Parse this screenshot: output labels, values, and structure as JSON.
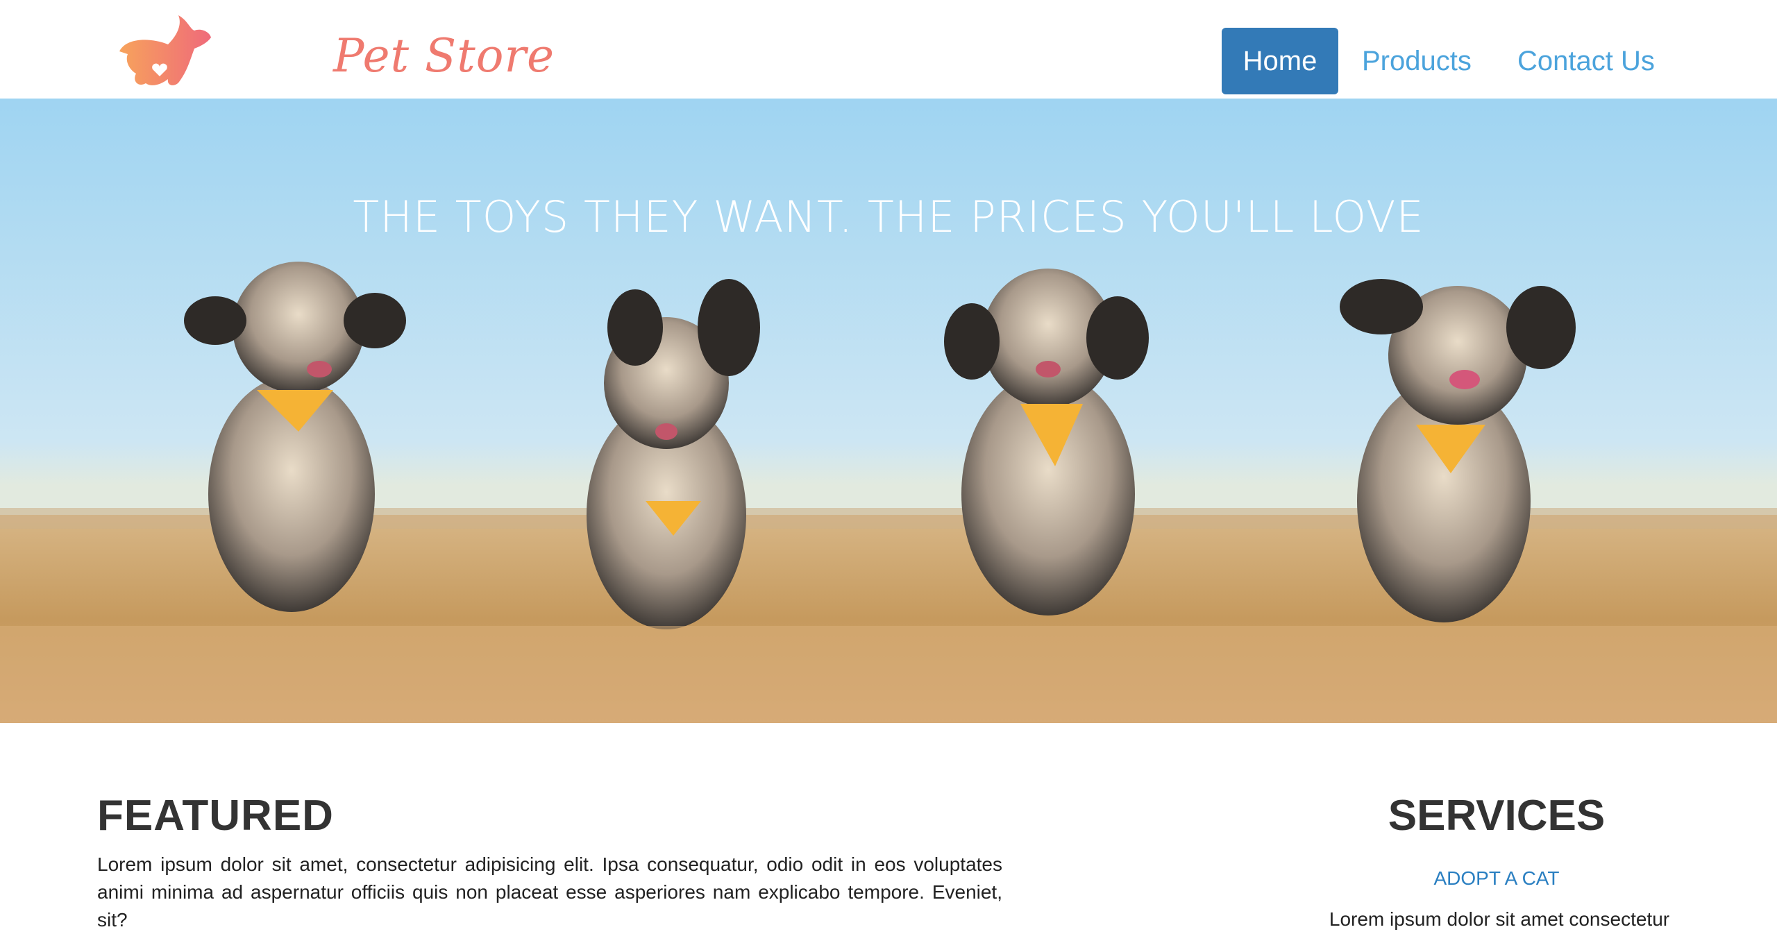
{
  "brand": {
    "name": "Pet Store"
  },
  "nav": {
    "home": "Home",
    "products": "Products",
    "contact": "Contact Us"
  },
  "hero": {
    "headline": "THE TOYS THEY WANT. THE PRICES YOU'LL LOVE"
  },
  "featured": {
    "title": "FEATURED",
    "text": "Lorem ipsum dolor sit amet, consectetur adipisicing elit. Ipsa consequatur, odio odit in eos voluptates animi minima ad aspernatur officiis quis non placeat esse asperiores nam explicabo tempore. Eveniet, sit?"
  },
  "services": {
    "title": "SERVICES",
    "link": "ADOPT A CAT",
    "text": "Lorem ipsum dolor sit amet consectetur"
  },
  "colors": {
    "nav_active": "#337ab7",
    "nav_link": "#4ba3dc",
    "brand": "#ef7a6f",
    "service_link": "#2a7fc1"
  },
  "icons": {
    "logo": "dog-logo-icon"
  }
}
